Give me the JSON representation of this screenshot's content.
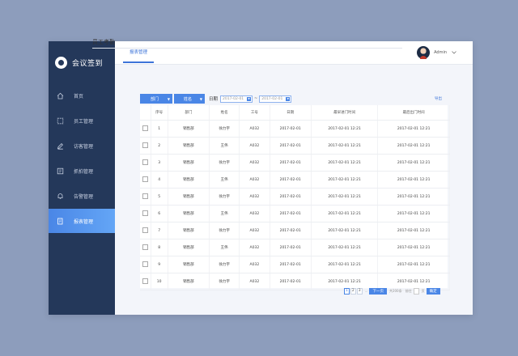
{
  "sidebar": {
    "logo_text": "会议签到",
    "items": [
      {
        "label": "首页",
        "icon": "home-icon"
      },
      {
        "label": "员工管理",
        "icon": "people-icon"
      },
      {
        "label": "访客管理",
        "icon": "edit-icon"
      },
      {
        "label": "抓拍管理",
        "icon": "photo-icon"
      },
      {
        "label": "告警管理",
        "icon": "bell-icon"
      },
      {
        "label": "报表管理",
        "icon": "report-icon",
        "active": true
      }
    ]
  },
  "header": {
    "tab_label": "报表管理",
    "user_name": "Admin"
  },
  "main": {
    "title": "员工考勤",
    "filters": {
      "department_label": "部门",
      "name_label": "姓名",
      "date_label": "日期",
      "date_start": "2017-02-01",
      "date_sep": "~",
      "date_end": "2017-02-01"
    },
    "export_label": "导出",
    "table": {
      "columns": [
        "序号",
        "部门",
        "姓名",
        "工号",
        "日期",
        "最早进门时间",
        "最后出门时间"
      ],
      "rows": [
        [
          "1",
          "销售部",
          "徐力宇",
          "A032",
          "2017-02-01",
          "2017-02-01 12:21",
          "2017-02-01 12:21"
        ],
        [
          "2",
          "销售部",
          "王伟",
          "A032",
          "2017-02-01",
          "2017-02-01 12:21",
          "2017-02-01 12:21"
        ],
        [
          "3",
          "销售部",
          "徐力宇",
          "A032",
          "2017-02-01",
          "2017-02-01 12:21",
          "2017-02-01 12:21"
        ],
        [
          "4",
          "销售部",
          "王伟",
          "A032",
          "2017-02-01",
          "2017-02-01 12:21",
          "2017-02-01 12:21"
        ],
        [
          "5",
          "销售部",
          "徐力宇",
          "A032",
          "2017-02-01",
          "2017-02-01 12:21",
          "2017-02-01 12:21"
        ],
        [
          "6",
          "销售部",
          "王伟",
          "A032",
          "2017-02-01",
          "2017-02-01 12:21",
          "2017-02-01 12:21"
        ],
        [
          "7",
          "销售部",
          "徐力宇",
          "A032",
          "2017-02-01",
          "2017-02-01 12:21",
          "2017-02-01 12:21"
        ],
        [
          "8",
          "销售部",
          "王伟",
          "A032",
          "2017-02-01",
          "2017-02-01 12:21",
          "2017-02-01 12:21"
        ],
        [
          "9",
          "销售部",
          "徐力宇",
          "A032",
          "2017-02-01",
          "2017-02-01 12:21",
          "2017-02-01 12:21"
        ],
        [
          "10",
          "销售部",
          "徐力宇",
          "A032",
          "2017-02-01",
          "2017-02-01 12:21",
          "2017-02-01 12:21"
        ]
      ]
    },
    "pagination": {
      "pages": [
        "1",
        "2",
        "3"
      ],
      "current": "1",
      "ellipsis": "...",
      "next_label": "下一页",
      "total_text": "共200条",
      "goto_text": "前往",
      "page_unit": "页",
      "confirm_label": "确定"
    }
  },
  "colors": {
    "background": "#8d9dbc",
    "sidebar": "#24385a",
    "accent": "#4a86e6"
  }
}
